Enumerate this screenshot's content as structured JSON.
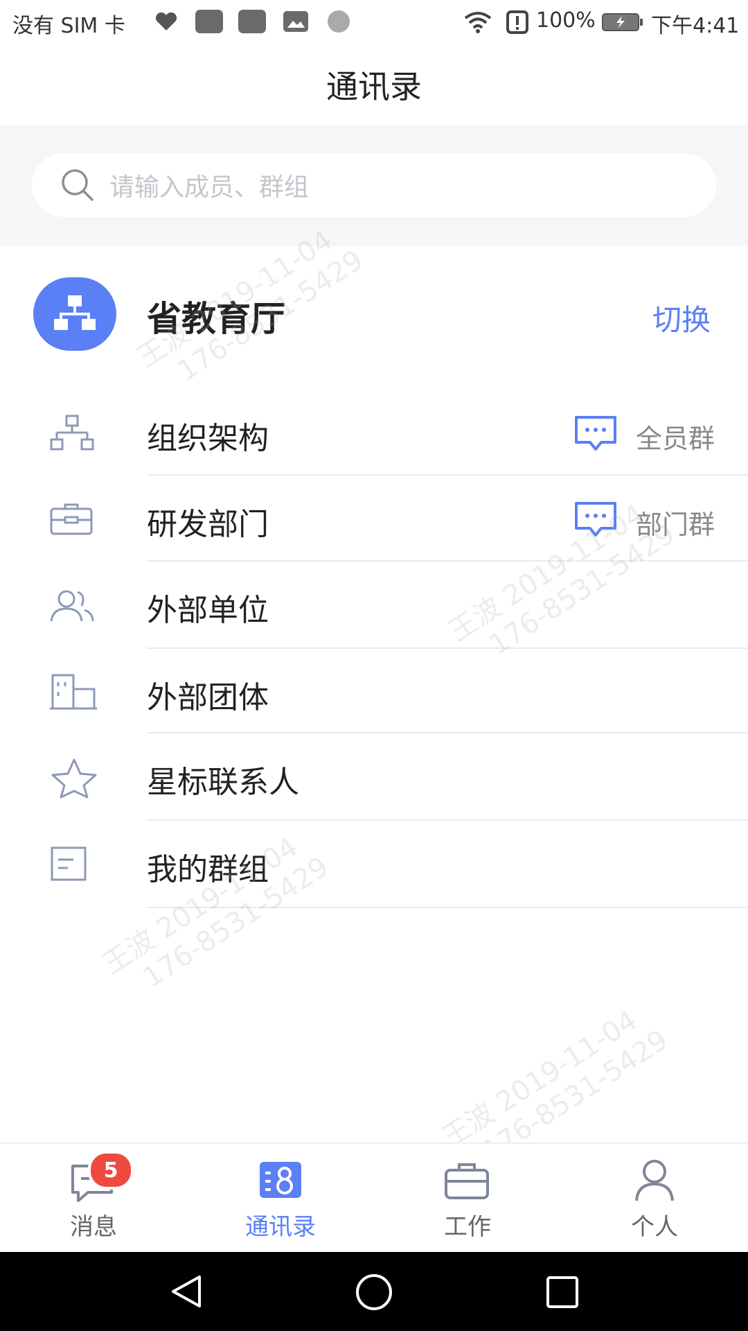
{
  "status_bar": {
    "carrier": "没有 SIM 卡",
    "battery": "100%",
    "time": "下午4:41"
  },
  "header": {
    "title": "通讯录"
  },
  "search": {
    "placeholder": "请输入成员、群组"
  },
  "org": {
    "name": "省教育厅",
    "switch_label": "切换"
  },
  "list": {
    "items": [
      {
        "label": "组织架构",
        "icon": "org-chart-icon",
        "right": "全员群"
      },
      {
        "label": "研发部门",
        "icon": "briefcase-icon",
        "right": "部门群"
      },
      {
        "label": "外部单位",
        "icon": "people-icon"
      },
      {
        "label": "外部团体",
        "icon": "building-icon"
      },
      {
        "label": "星标联系人",
        "icon": "star-icon"
      },
      {
        "label": "我的群组",
        "icon": "group-list-icon"
      }
    ]
  },
  "watermark": {
    "name": "王波 2019-11-04",
    "phone": "176-8531-5429"
  },
  "bottom_nav": {
    "items": [
      {
        "label": "消息",
        "badge": "5"
      },
      {
        "label": "通讯录"
      },
      {
        "label": "工作"
      },
      {
        "label": "个人"
      }
    ]
  },
  "colors": {
    "accent": "#5b7ff5",
    "badge": "#ef4a3f",
    "icon_stroke": "#8d99b8"
  }
}
